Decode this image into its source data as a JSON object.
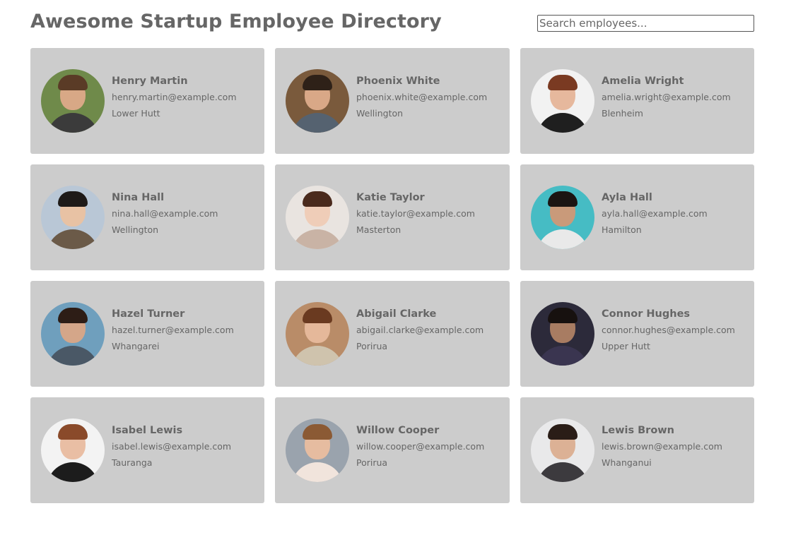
{
  "header": {
    "title": "Awesome Startup Employee Directory",
    "search_placeholder": "Search employees..."
  },
  "employees": [
    {
      "name": "Henry Martin",
      "email": "henry.martin@example.com",
      "city": "Lower Hutt",
      "avatar": {
        "bg": "#6f8a4a",
        "skin": "#d8a886",
        "hair": "#5a3b26",
        "shirt": "#3b3b3b"
      }
    },
    {
      "name": "Phoenix White",
      "email": "phoenix.white@example.com",
      "city": "Wellington",
      "avatar": {
        "bg": "#7a5a3c",
        "skin": "#d9a887",
        "hair": "#2e2118",
        "shirt": "#556270"
      }
    },
    {
      "name": "Amelia Wright",
      "email": "amelia.wright@example.com",
      "city": "Blenheim",
      "avatar": {
        "bg": "#f2f2f2",
        "skin": "#e6b89d",
        "hair": "#7a3a22",
        "shirt": "#1f1f1f"
      }
    },
    {
      "name": "Nina Hall",
      "email": "nina.hall@example.com",
      "city": "Wellington",
      "avatar": {
        "bg": "#b9c7d6",
        "skin": "#e8c2a4",
        "hair": "#1e1a18",
        "shirt": "#6b5a48"
      }
    },
    {
      "name": "Katie Taylor",
      "email": "katie.taylor@example.com",
      "city": "Masterton",
      "avatar": {
        "bg": "#e9e4e0",
        "skin": "#efcdb8",
        "hair": "#4a2a1c",
        "shirt": "#c9b3a5"
      }
    },
    {
      "name": "Ayla Hall",
      "email": "ayla.hall@example.com",
      "city": "Hamilton",
      "avatar": {
        "bg": "#46bcc4",
        "skin": "#c99a7a",
        "hair": "#1b1512",
        "shirt": "#e9e9e9"
      }
    },
    {
      "name": "Hazel Turner",
      "email": "hazel.turner@example.com",
      "city": "Whangarei",
      "avatar": {
        "bg": "#6f9fbd",
        "skin": "#d4a689",
        "hair": "#2d1d16",
        "shirt": "#4a5866"
      }
    },
    {
      "name": "Abigail Clarke",
      "email": "abigail.clarke@example.com",
      "city": "Porirua",
      "avatar": {
        "bg": "#b98c68",
        "skin": "#e5b89a",
        "hair": "#6a3a20",
        "shirt": "#cfc3ad"
      }
    },
    {
      "name": "Connor Hughes",
      "email": "connor.hughes@example.com",
      "city": "Upper Hutt",
      "avatar": {
        "bg": "#2c2a3a",
        "skin": "#a87c62",
        "hair": "#17110f",
        "shirt": "#3a3550"
      }
    },
    {
      "name": "Isabel Lewis",
      "email": "isabel.lewis@example.com",
      "city": "Tauranga",
      "avatar": {
        "bg": "#f3f3f3",
        "skin": "#e9bea4",
        "hair": "#8a4a2a",
        "shirt": "#1c1c1c"
      }
    },
    {
      "name": "Willow Cooper",
      "email": "willow.cooper@example.com",
      "city": "Porirua",
      "avatar": {
        "bg": "#9aa3ad",
        "skin": "#e6bca0",
        "hair": "#8b5a34",
        "shirt": "#f1e4dc"
      }
    },
    {
      "name": "Lewis Brown",
      "email": "lewis.brown@example.com",
      "city": "Whanganui",
      "avatar": {
        "bg": "#e9e9ea",
        "skin": "#dcb195",
        "hair": "#2a1d17",
        "shirt": "#3c3a3e"
      }
    }
  ]
}
